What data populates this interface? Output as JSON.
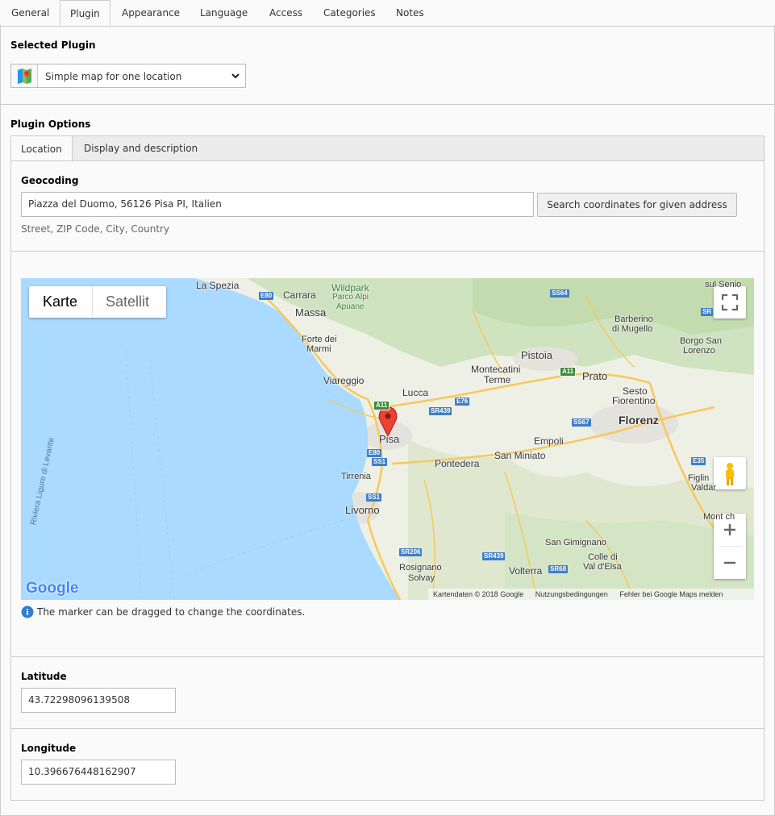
{
  "top_tabs": [
    "General",
    "Plugin",
    "Appearance",
    "Language",
    "Access",
    "Categories",
    "Notes"
  ],
  "active_top_tab": "Plugin",
  "selected_plugin": {
    "title": "Selected Plugin",
    "value": "Simple map for one location"
  },
  "plugin_options": {
    "title": "Plugin Options",
    "tabs": [
      "Location",
      "Display and description"
    ],
    "active_tab": "Location"
  },
  "geocoding": {
    "label": "Geocoding",
    "address": "Piazza del Duomo, 56126 Pisa PI, Italien",
    "button": "Search coordinates for given address",
    "help": "Street, ZIP Code, City, Country"
  },
  "map": {
    "type_buttons": [
      "Karte",
      "Satellit"
    ],
    "active_type": "Karte",
    "places": {
      "la_spezia": "La Spezia",
      "carrara": "Carrara",
      "wildpark": "Wildpark",
      "wildpark2": "Parco Alpi",
      "wildpark3": "Apuane",
      "massa": "Massa",
      "forte1": "Forte dei",
      "forte2": "Marmi",
      "viareggio": "Viareggio",
      "lucca": "Lucca",
      "pisa": "Pisa",
      "pontedera": "Pontedera",
      "tirrenia": "Tirrenia",
      "livorno": "Livorno",
      "rosignano1": "Rosignano",
      "rosignano2": "Solvay",
      "pistoia": "Pistoia",
      "montecatini1": "Montecatini",
      "montecatini2": "Terme",
      "prato": "Prato",
      "sesto1": "Sesto",
      "sesto2": "Fiorentino",
      "florenz": "Florenz",
      "empoli": "Empoli",
      "sanminiato": "San Miniato",
      "sangimignano": "San Gimignano",
      "colle1": "Colle di",
      "colle2": "Val d'Elsa",
      "volterra": "Volterra",
      "barberino1": "Barberino",
      "barberino2": "di Mugello",
      "borgo1": "Borgo San",
      "borgo2": "Lorenzo",
      "figline": "Figlin",
      "figline2": "Valdar",
      "sulsenio": "sul Senio",
      "sea": "Riviera Ligure di Levante",
      "montevarchi": "Mont ch"
    },
    "roads": [
      "E80",
      "SS64",
      "A11",
      "A11",
      "E76",
      "SR439",
      "SS67",
      "E80",
      "SS1",
      "SS1",
      "SR206",
      "SR439",
      "SR68",
      "E35",
      "SR"
    ],
    "attribution": [
      "Kartendaten © 2018 Google",
      "Nutzungsbedingungen",
      "Fehler bei Google Maps melden"
    ],
    "logo": "Google",
    "colors": {
      "water": "#aadaff",
      "land": "#eef0e6",
      "forest": "#cfe3c0",
      "urban": "#e4e2dc",
      "motorway": "#f7c85a",
      "marker": "#ea4335"
    }
  },
  "marker_note": "The marker can be dragged to change the coordinates.",
  "latitude": {
    "label": "Latitude",
    "value": "43.72298096139508"
  },
  "longitude": {
    "label": "Longitude",
    "value": "10.396676448162907"
  }
}
